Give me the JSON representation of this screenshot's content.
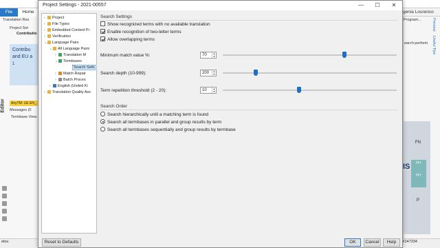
{
  "background": {
    "file_tab": "File",
    "home_tab": "Home",
    "user_name": "Eugenia Lourenco",
    "left_tab_1": "Translation Res",
    "left_tab_2": "Project Set",
    "contrib_label": "Contributio",
    "blue_box_line1": "Contribu",
    "blue_box_line2": "and EU a",
    "blue_box_number": "1",
    "anytm_label": "AnyTM: UE EN_",
    "messages_label": "Messages (0",
    "termbase_viewer": "Termbase View",
    "editor_vertical": "Editor",
    "status_left": "elou",
    "status_right": "0/147334",
    "right_program": "Program...",
    "right_search_perf": "earch perform",
    "side_tabs": [
      "Preview",
      "Useful Tips"
    ],
    "grid_cells": [
      {
        "text": "FN",
        "teal": false
      },
      {
        "text": "H+",
        "teal": true
      },
      {
        "text": "H+",
        "teal": true
      },
      {
        "text": "P",
        "teal": false
      }
    ],
    "is_text": "IS"
  },
  "dialog": {
    "title": "Project Settings - 2021-00557",
    "minimize_symbol": "—",
    "maximize_symbol": "☐",
    "close_symbol": "✕",
    "tree": [
      {
        "label": "Project",
        "exp": "›",
        "icon": "#e4b33b"
      },
      {
        "label": "File Types",
        "exp": "›",
        "icon": "#e4b33b"
      },
      {
        "label": "Embedded Content Pr",
        "exp": "›",
        "icon": "#e4b33b"
      },
      {
        "label": "Verification",
        "exp": "›",
        "icon": "#e4b33b"
      },
      {
        "label": "Language Pairs",
        "exp": "⌄",
        "icon": "#e4b33b"
      },
      {
        "label": "All Language Pairs",
        "exp": "⌄",
        "icon": "#e4b33b"
      },
      {
        "label": "Translation M",
        "exp": "›",
        "icon": "#3aa55e"
      },
      {
        "label": "Termbases",
        "exp": "⌄",
        "icon": "#3aa55e"
      },
      {
        "label": "Search Setti",
        "exp": "",
        "icon": ""
      },
      {
        "label": "Match Repair",
        "exp": "›",
        "icon": "#e08a2b"
      },
      {
        "label": "Batch Proces",
        "exp": "›",
        "icon": "#888888"
      },
      {
        "label": "English (United Ki",
        "exp": "›",
        "icon": "#3a78c5"
      },
      {
        "label": "Translation Quality Ass",
        "exp": "›",
        "icon": "#e4b33b"
      }
    ],
    "search_settings": {
      "section_title": "Search Settings",
      "checkboxes": [
        {
          "label": "Show recognized terms with no available translation",
          "checked": false
        },
        {
          "label": "Enable recognition of two-letter terms",
          "checked": true
        },
        {
          "label": "Allow overlapping terms",
          "checked": true
        }
      ],
      "min_match_label": "Minimum match value %:",
      "min_match_value": "70",
      "min_match_fraction": 0.7,
      "search_depth_label": "Search depth (10-999):",
      "search_depth_value": "200",
      "search_depth_fraction": 0.19,
      "term_rep_label": "Term repetition threshold (2 - 20):",
      "term_rep_value": "10",
      "term_rep_fraction": 0.44
    },
    "search_order": {
      "section_title": "Search Order",
      "options": [
        {
          "label": "Search hierarchically until a matching term is found",
          "checked": false
        },
        {
          "label": "Search all termbases in parallel and group results by term",
          "checked": true
        },
        {
          "label": "Search all termbases sequentially and group results by termbase",
          "checked": false
        }
      ]
    },
    "buttons": {
      "reset": "Reset to Defaults",
      "ok": "OK",
      "cancel": "Cancel",
      "help": "Help"
    }
  }
}
